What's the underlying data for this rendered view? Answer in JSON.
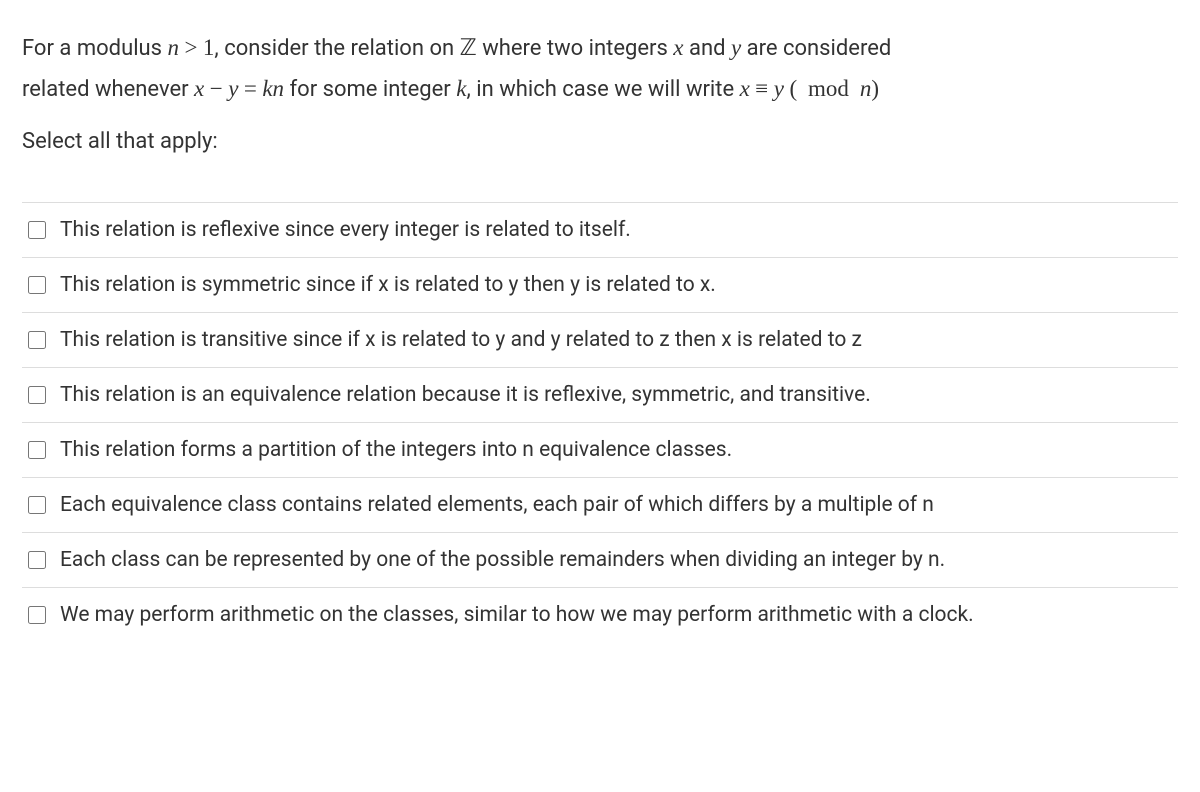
{
  "question": {
    "line1_pre": "For a modulus ",
    "n": "n",
    "gt": ">",
    "one": "1",
    "line1_mid": ", consider the relation on ",
    "Z": "ℤ",
    "line1_mid2": " where two integers ",
    "x": "x",
    "and": " and ",
    "y": "y",
    "line1_end": " are considered",
    "line2_pre": "related whenever ",
    "minus": "−",
    "eq": "=",
    "k": "k",
    "line2_mid": " for some integer ",
    "line2_mid2": ", in which case we will write ",
    "equiv": "≡",
    "lparen": "(",
    "mod": "mod",
    "rparen": ")"
  },
  "instruction": "Select all that apply:",
  "options": [
    "This relation is reflexive since every integer is related to itself.",
    "This relation is symmetric since if x is related to y then y is related to x.",
    "This relation is transitive since if x is related to y and y related to z then x is related to z",
    "This relation is an equivalence relation because it is reflexive, symmetric, and transitive.",
    "This relation forms a partition of the integers into n equivalence classes.",
    "Each equivalence class contains related elements, each pair of which differs by a multiple of n",
    "Each class can be represented by one of the possible remainders when dividing an integer by n.",
    "We may perform arithmetic on the classes, similar to how we may perform arithmetic with a clock."
  ]
}
